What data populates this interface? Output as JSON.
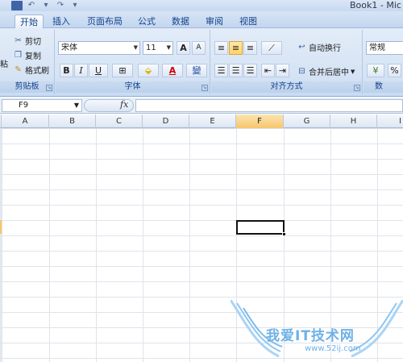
{
  "title_bar": {
    "doc_title": "Book1 - Mic"
  },
  "tabs": [
    {
      "label": "开始",
      "active": true
    },
    {
      "label": "插入"
    },
    {
      "label": "页面布局"
    },
    {
      "label": "公式"
    },
    {
      "label": "数据"
    },
    {
      "label": "审阅"
    },
    {
      "label": "视图"
    }
  ],
  "clipboard": {
    "paste_label": "粘",
    "cut_label": "剪切",
    "copy_label": "复制",
    "format_painter_label": "格式刷",
    "group_label": "剪贴板"
  },
  "font": {
    "font_name": "宋体",
    "font_size": "11",
    "grow_label": "A",
    "shrink_label": "A",
    "bold_label": "B",
    "italic_label": "I",
    "underline_label": "U",
    "font_color_label": "A",
    "phonetic_label": "變",
    "group_label": "字体"
  },
  "alignment": {
    "wrap_text_label": "自动换行",
    "merge_center_label": "合并后居中",
    "group_label": "对齐方式"
  },
  "number": {
    "format_value": "常规",
    "percent_label": "%",
    "group_label": "数"
  },
  "formula_bar": {
    "name_box_value": "F9",
    "fx_label": "fx"
  },
  "sheet": {
    "columns": [
      "A",
      "B",
      "C",
      "D",
      "E",
      "F",
      "G",
      "H",
      "I"
    ],
    "selected_column": "F"
  },
  "watermark": {
    "text": "我爱IT技术网",
    "url": "www.52ij.com"
  },
  "colors": {
    "accent": "#15428b",
    "selected_header": "#f7c56b",
    "ribbon": "#d5e3f4"
  }
}
